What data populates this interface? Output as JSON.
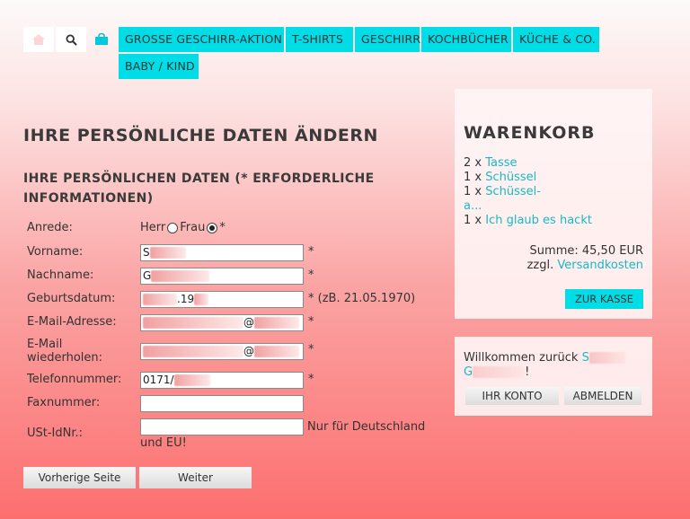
{
  "nav": {
    "categories": [
      "GROSSE GESCHIRR-AKTION",
      "T-SHIRTS",
      "GESCHIRR",
      "KOCHBÜCHER",
      "KÜCHE & CO.",
      "BABY / KIND"
    ],
    "home_icon": "home-icon",
    "search_icon": "search-icon",
    "cart_icon": "shopping-bag-icon",
    "accent_color": "#00dde6"
  },
  "form": {
    "page_title": "IHRE PERSÖNLICHE DATEN ÄNDERN",
    "section_title": "IHRE PERSÖNLICHEN DATEN (* ERFORDERLICHE INFORMATIONEN)",
    "salutation": {
      "label": "Anrede:",
      "option_herr": "Herr",
      "option_frau": "Frau",
      "selected": "Frau",
      "required_mark": "*"
    },
    "fields": {
      "vorname": {
        "label": "Vorname:",
        "value": "S",
        "required": "*"
      },
      "nachname": {
        "label": "Nachname:",
        "value": "G",
        "required": "*"
      },
      "geburtsdatum": {
        "label": "Geburtsdatum:",
        "value": ".19",
        "required": "* (zB. 21.05.1970)"
      },
      "email": {
        "label": "E-Mail-Adresse:",
        "value": "@",
        "required": "*"
      },
      "email_repeat": {
        "label_line1": "E-Mail",
        "label_line2": "wiederholen:",
        "value": "@",
        "required": "*"
      },
      "telefon": {
        "label": "Telefonnummer:",
        "value": "0171/",
        "required": "*"
      },
      "fax": {
        "label": "Faxnummer:",
        "value": ""
      },
      "ustid": {
        "label": "USt-IdNr.:",
        "value": "",
        "note": "Nur für Deutschland und EU!"
      }
    },
    "back_button": "Vorherige Seite",
    "next_button": "Weiter"
  },
  "cart": {
    "title": "WARENKORB",
    "items": [
      {
        "qty": "2 x",
        "name": "Tasse"
      },
      {
        "qty": "1 x",
        "name": "Schüssel"
      },
      {
        "qty": "1 x",
        "name": "Schüssel-a..."
      },
      {
        "qty": "1 x",
        "name": "Ich glaub es hackt"
      }
    ],
    "sum_label": "Summe: 45,50 EUR",
    "shipping_prefix": "zzgl.",
    "shipping_link": "Versandkosten",
    "checkout_button": "ZUR KASSE"
  },
  "account": {
    "welcome": "Willkommen zurück",
    "name_first": "S",
    "name_last": "G",
    "exclamation": "!",
    "account_button": "IHR KONTO",
    "logout_button": "ABMELDEN"
  }
}
